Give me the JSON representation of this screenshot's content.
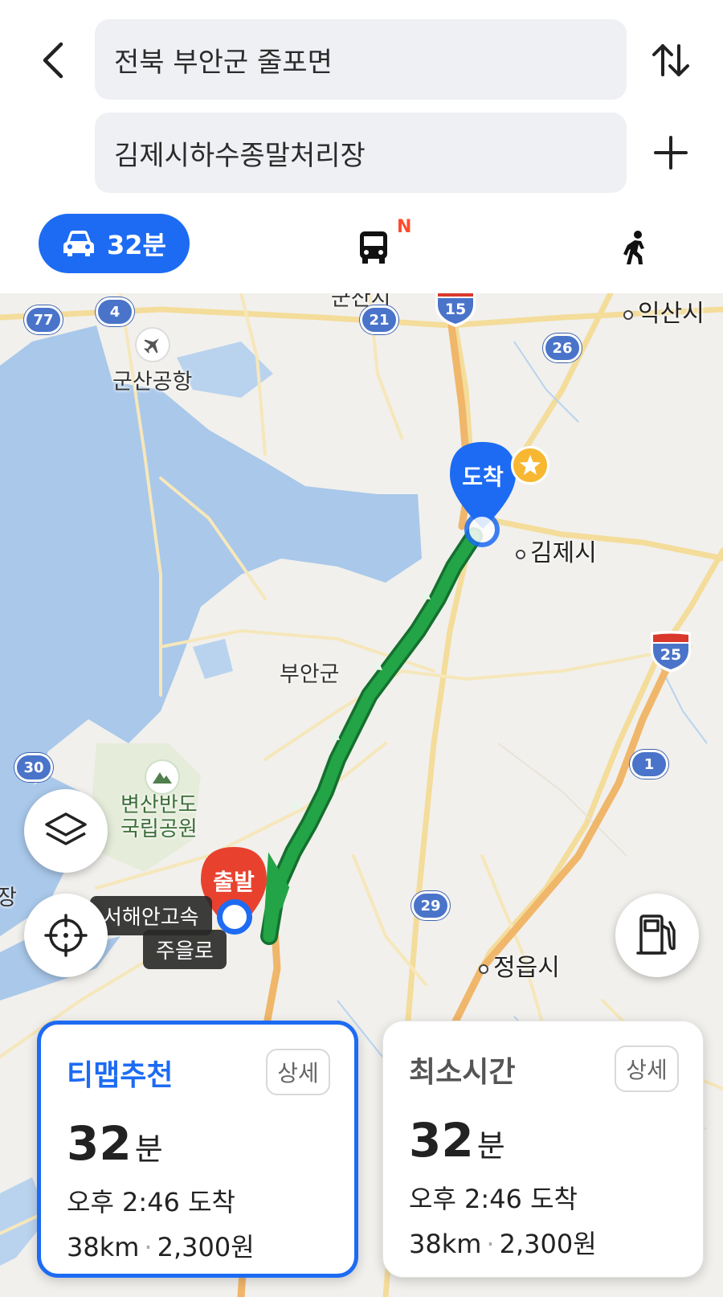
{
  "search": {
    "origin": "전북 부안군 줄포면",
    "destination": "김제시하수종말처리장"
  },
  "modes": {
    "car_time": "32분",
    "bus_badge": "N"
  },
  "map": {
    "places": {
      "iksan": "익산시",
      "gunsan_airport": "군산공항",
      "gimje": "김제시",
      "buan": "부안군",
      "byeonsan": "변산반도",
      "national_park": "국립공원",
      "jeongeup": "정읍시",
      "partial_top": "군산시",
      "partial_left": "장"
    },
    "road_shields": [
      "77",
      "4",
      "21",
      "26",
      "30",
      "1",
      "29"
    ],
    "highways": [
      "15",
      "25"
    ],
    "road_names": {
      "seohaean_partial": "서해안고속",
      "juel_ro": "주을로"
    },
    "pins": {
      "destination": "도착",
      "origin": "출발"
    }
  },
  "routes": [
    {
      "title": "티맵추천",
      "detail": "상세",
      "time_value": "32",
      "time_unit": "분",
      "arrival": "오후 2:46 도착",
      "distance": "38km",
      "fare": "2,300원"
    },
    {
      "title": "최소시간",
      "detail": "상세",
      "time_value": "32",
      "time_unit": "분",
      "arrival": "오후 2:46 도착",
      "distance": "38km",
      "fare": "2,300원"
    }
  ],
  "colors": {
    "accent": "#1d6bf3",
    "route": "#22a447",
    "origin_pin": "#e8412e",
    "dest_pin": "#1d6bf3",
    "water": "#a9c8ea"
  }
}
